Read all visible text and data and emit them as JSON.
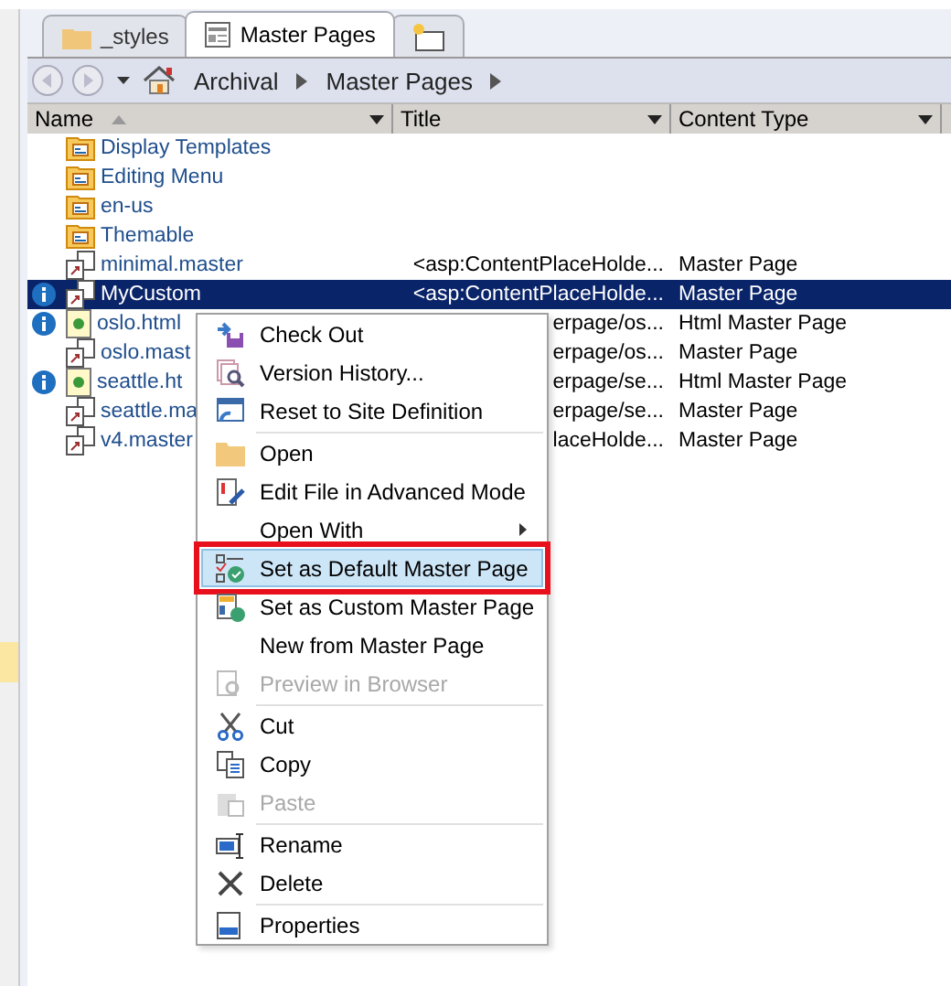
{
  "tabs": [
    {
      "label": "_styles",
      "kind": "folder",
      "selected": false
    },
    {
      "label": "Master Pages",
      "kind": "page",
      "selected": true
    },
    {
      "kind": "new",
      "selected": false
    }
  ],
  "breadcrumb": [
    "Archival",
    "Master Pages"
  ],
  "columns": [
    "Name",
    "Title",
    "Content Type"
  ],
  "rows": [
    {
      "kind": "folder",
      "name": "Display Templates",
      "selected": false,
      "info_badge": false
    },
    {
      "kind": "folder",
      "name": "Editing Menu",
      "selected": false,
      "info_badge": false
    },
    {
      "kind": "folder",
      "name": "en-us",
      "selected": false,
      "info_badge": false
    },
    {
      "kind": "folder",
      "name": "Themable",
      "selected": false,
      "info_badge": false
    },
    {
      "kind": "master",
      "name": "minimal.master",
      "title": "<asp:ContentPlaceHolde...",
      "content_type": "Master Page",
      "selected": false,
      "info_badge": false
    },
    {
      "kind": "master",
      "name": "MyCustom",
      "title": "<asp:ContentPlaceHolde...",
      "content_type": "Master Page",
      "selected": true,
      "info_badge": true
    },
    {
      "kind": "html",
      "name": "oslo.html",
      "title": "erpage/os...",
      "content_type": "Html Master Page",
      "selected": false,
      "info_badge": true
    },
    {
      "kind": "master",
      "name": "oslo.mast",
      "title": "erpage/os...",
      "content_type": "Master Page",
      "selected": false,
      "info_badge": false
    },
    {
      "kind": "html",
      "name": "seattle.ht",
      "title": "erpage/se...",
      "content_type": "Html Master Page",
      "selected": false,
      "info_badge": true
    },
    {
      "kind": "master",
      "name": "seattle.ma",
      "title": "erpage/se...",
      "content_type": "Master Page",
      "selected": false,
      "info_badge": false
    },
    {
      "kind": "master",
      "name": "v4.master",
      "title": "laceHolde...",
      "content_type": "Master Page",
      "selected": false,
      "info_badge": false
    }
  ],
  "context_menu": [
    {
      "kind": "item",
      "label": "Check Out",
      "disabled": false,
      "selected": false
    },
    {
      "kind": "item",
      "label": "Version History...",
      "disabled": false,
      "selected": false
    },
    {
      "kind": "item",
      "label": "Reset to Site Definition",
      "disabled": false,
      "selected": false
    },
    {
      "kind": "separator"
    },
    {
      "kind": "item",
      "label": "Open",
      "disabled": false,
      "selected": false
    },
    {
      "kind": "item",
      "label": "Edit File in Advanced Mode",
      "disabled": false,
      "selected": false
    },
    {
      "kind": "submenu",
      "label": "Open With",
      "disabled": false,
      "selected": false
    },
    {
      "kind": "item",
      "label": "Set as Default Master Page",
      "disabled": false,
      "selected": true
    },
    {
      "kind": "item",
      "label": "Set as Custom Master Page",
      "disabled": false,
      "selected": false
    },
    {
      "kind": "item",
      "label": "New from Master Page",
      "disabled": false,
      "selected": false
    },
    {
      "kind": "item",
      "label": "Preview in Browser",
      "disabled": true,
      "selected": false
    },
    {
      "kind": "separator"
    },
    {
      "kind": "item",
      "label": "Cut",
      "disabled": false,
      "selected": false
    },
    {
      "kind": "item",
      "label": "Copy",
      "disabled": false,
      "selected": false
    },
    {
      "kind": "item",
      "label": "Paste",
      "disabled": true,
      "selected": false
    },
    {
      "kind": "separator"
    },
    {
      "kind": "item",
      "label": "Rename",
      "disabled": false,
      "selected": false
    },
    {
      "kind": "item",
      "label": "Delete",
      "disabled": false,
      "selected": false
    },
    {
      "kind": "separator"
    },
    {
      "kind": "item",
      "label": "Properties",
      "disabled": false,
      "selected": false
    }
  ]
}
